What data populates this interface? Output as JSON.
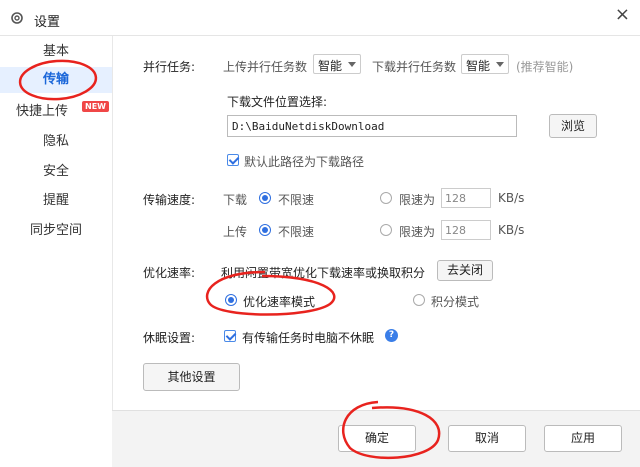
{
  "window": {
    "title": "设置",
    "close_glyph": "×"
  },
  "sidebar": {
    "items": [
      {
        "label": "基本"
      },
      {
        "label": "传输",
        "active": true
      },
      {
        "label": "快捷上传",
        "badge": "NEW"
      },
      {
        "label": "隐私"
      },
      {
        "label": "安全"
      },
      {
        "label": "提醒"
      },
      {
        "label": "同步空间"
      }
    ]
  },
  "parallel": {
    "label": "并行任务:",
    "upload_label": "上传并行任务数",
    "upload_value": "智能",
    "download_label": "下载并行任务数",
    "download_value": "智能",
    "hint": "(推荐智能)"
  },
  "download_location": {
    "label": "下载文件位置选择:",
    "path": "D:\\BaiduNetdiskDownload",
    "browse_label": "浏览",
    "default_label": "默认此路径为下载路径",
    "default_checked": true
  },
  "speed": {
    "label": "传输速度:",
    "download": {
      "label": "下载",
      "unlimited": "不限速",
      "limited": "限速为",
      "value": "128",
      "unit": "KB/s"
    },
    "upload": {
      "label": "上传",
      "unlimited": "不限速",
      "limited": "限速为",
      "value": "128",
      "unit": "KB/s"
    }
  },
  "optimize": {
    "label": "优化速率:",
    "desc": "利用闲置带宽优化下载速率或换取积分",
    "close_label": "去关闭",
    "mode_speed": "优化速率模式",
    "mode_points": "积分模式"
  },
  "sleep": {
    "label": "休眠设置:",
    "option": "有传输任务时电脑不休眠",
    "checked": true,
    "help_glyph": "?"
  },
  "other_settings_label": "其他设置",
  "footer": {
    "ok_label": "确定",
    "cancel_label": "取消",
    "apply_label": "应用"
  },
  "colors": {
    "accent": "#2f6fe0",
    "annotation": "#e8231e",
    "badge": "#f04747"
  },
  "icons": {
    "title": "gear-icon",
    "help": "help-icon"
  }
}
